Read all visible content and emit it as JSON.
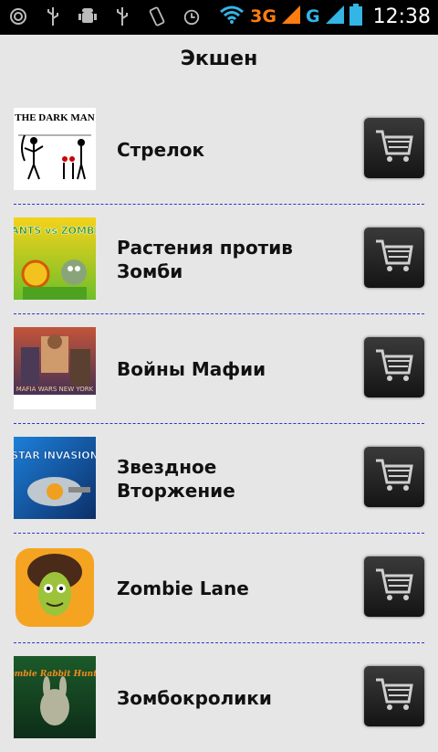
{
  "status": {
    "icons": [
      "target-icon",
      "usb-icon",
      "android-debug-icon",
      "usb-icon",
      "vibrate-icon",
      "alarm-icon",
      "wifi-icon"
    ],
    "network_3g": "3G",
    "network_g": "G",
    "time": "12:38"
  },
  "header": {
    "title": "Экшен"
  },
  "items": [
    {
      "name": "Стрелок",
      "thumb_text": "THE DARK MAN"
    },
    {
      "name": "Растения против Зомби",
      "thumb_text": "PLANTS vs ZOMBIES"
    },
    {
      "name": "Войны Мафии",
      "thumb_text": "MAFIA WARS NEW YORK"
    },
    {
      "name": "Звездное Вторжение",
      "thumb_text": "STAR INVASION"
    },
    {
      "name": "Zombie Lane",
      "thumb_text": ""
    },
    {
      "name": "Зомбокролики",
      "thumb_text": "Zombie Rabbit Hunter"
    }
  ]
}
